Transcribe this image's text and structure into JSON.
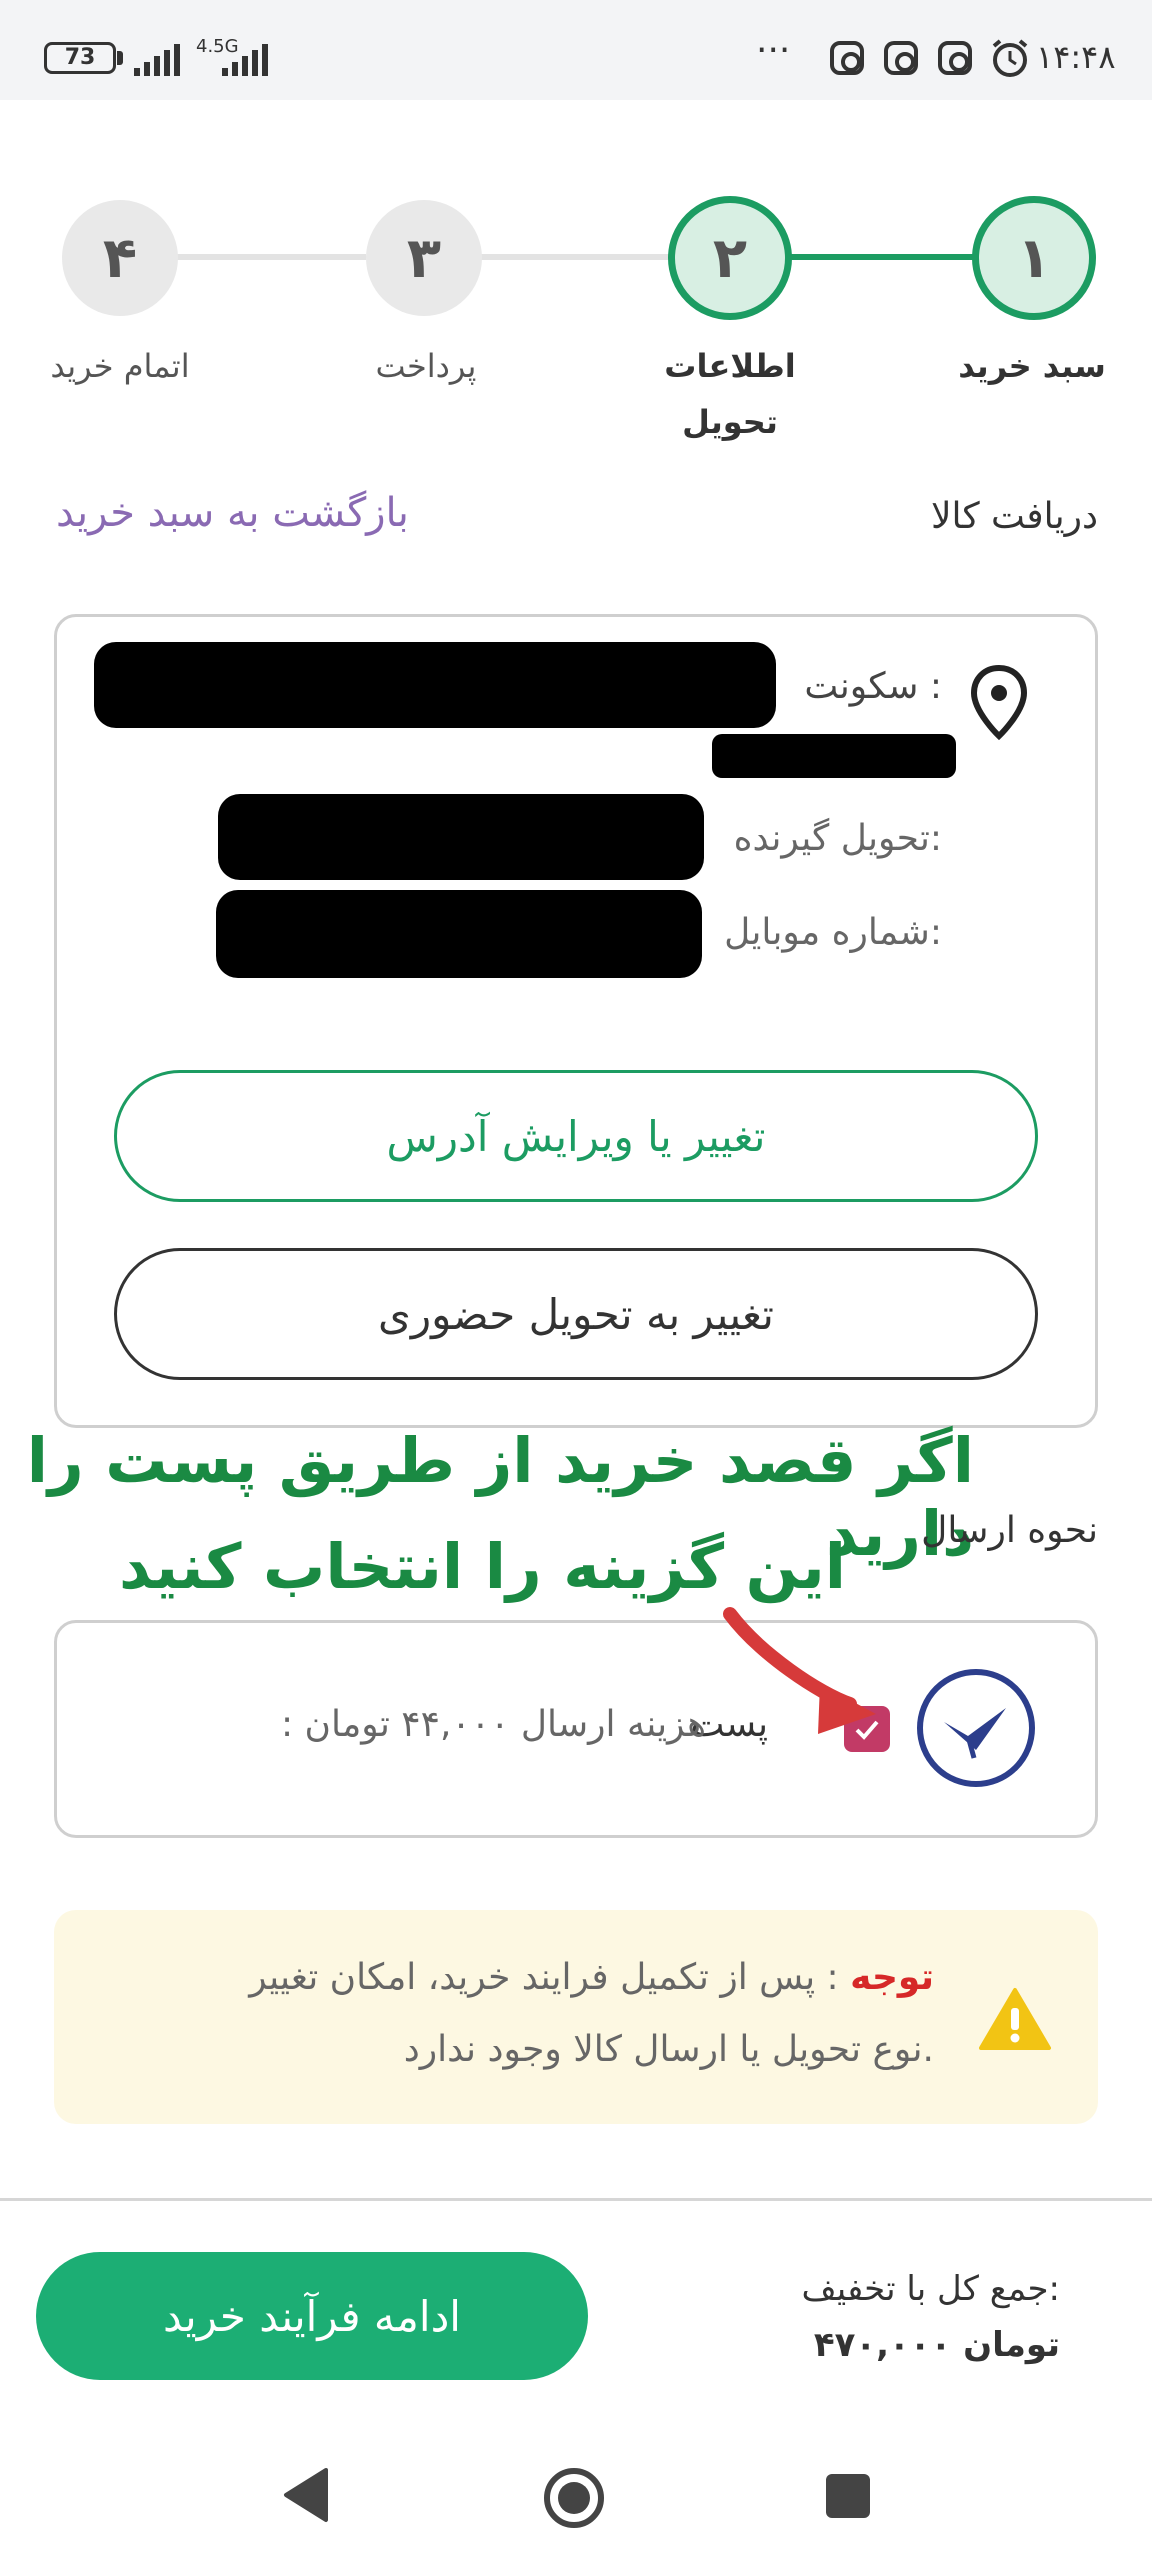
{
  "status_bar": {
    "time": "۱۴:۴۸",
    "battery": "73",
    "network": "4.5G",
    "more": "···",
    "icons": [
      "alarm-icon",
      "instagram-icon",
      "instagram-icon",
      "instagram-icon"
    ]
  },
  "stepper": {
    "steps": [
      {
        "number": "۱",
        "label": "سبد خرید",
        "state": "done"
      },
      {
        "number": "۲",
        "label_line1": "اطلاعات",
        "label_line2": "تحویل",
        "state": "current"
      },
      {
        "number": "۳",
        "label": "پرداخت",
        "state": "pending"
      },
      {
        "number": "۴",
        "label": "اتمام خرید",
        "state": "pending"
      }
    ],
    "active_color": "#1c9c62"
  },
  "receive": {
    "title": "دریافت کالا",
    "back_link": "بازگشت به سبد خرید"
  },
  "address_card": {
    "residence_label": "سکونت :",
    "receiver_label": "تحویل گیرنده:",
    "mobile_label": "شماره موبایل:",
    "edit_address_button": "تغییر یا ویرایش آدرس",
    "in_person_button": "تغییر به تحویل حضوری",
    "location_icon": "location-pin-icon"
  },
  "annotation": {
    "line1": "اگر قصد خرید از طریق پست را دارید",
    "line2": "این گزینه را انتخاب کنید"
  },
  "shipping": {
    "title": "نحوه ارسال",
    "option_label": "پست",
    "option_cost": ": هزینه ارسال ۴۴,۰۰۰ تومان",
    "checked": true,
    "icon": "post-logo-icon"
  },
  "notice": {
    "label": "توجه",
    "text_line1": ": پس از تکمیل فرایند خرید، امکان تغییر",
    "text_line2": "نوع تحویل یا ارسال کالا وجود ندارد.",
    "icon": "warning-icon"
  },
  "footer": {
    "total_label": "جمع کل با تخفیف:",
    "total_value": "۴۷۰,۰۰۰ تومان",
    "continue_button": "ادامه فرآیند خرید"
  },
  "nav": {
    "back": "back-triangle-icon",
    "home": "home-circle-icon",
    "recents": "recents-square-icon"
  },
  "colors": {
    "brand_green": "#1cae74",
    "annotation_green": "#1a8a43",
    "checkbox": "#c23a66",
    "arrow": "#d63a3a",
    "notice_bg": "#fdf8e2",
    "link_purple": "#8a6ab3"
  }
}
